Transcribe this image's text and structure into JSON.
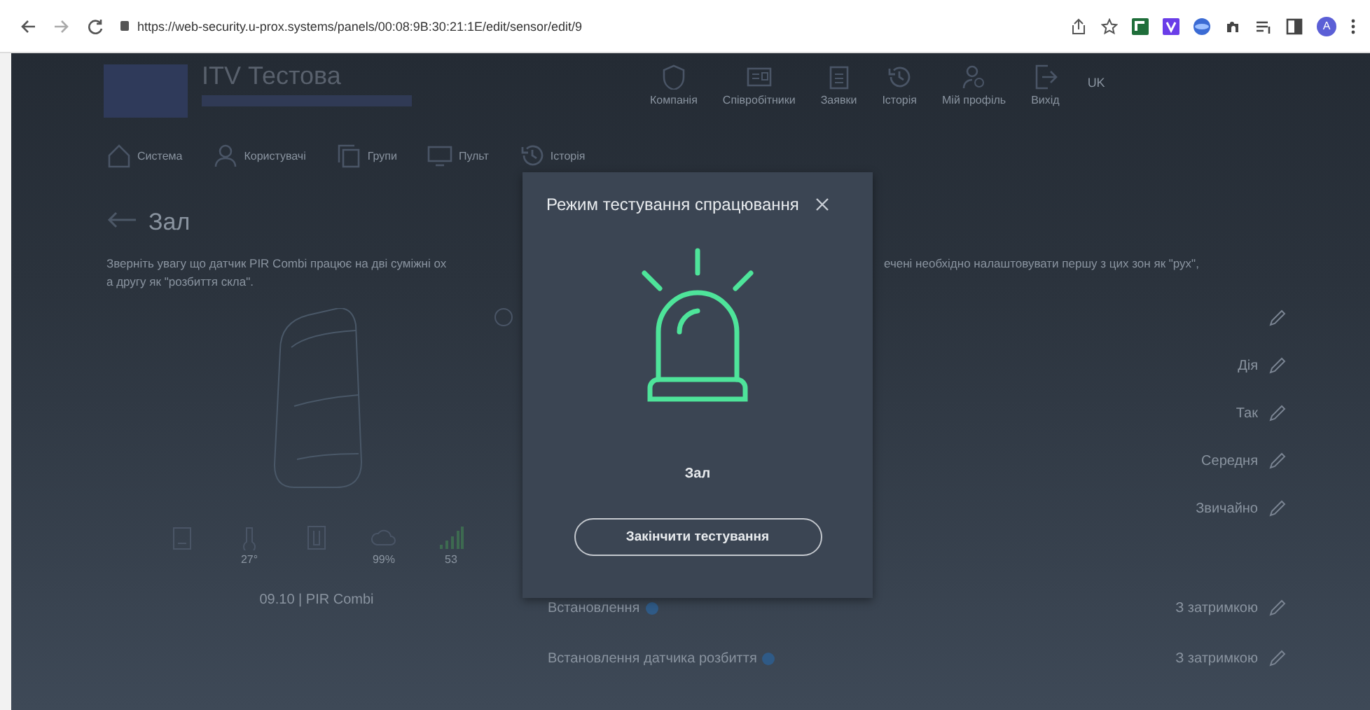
{
  "browser": {
    "url": "https://web-security.u-prox.systems/panels/00:08:9B:30:21:1E/edit/sensor/edit/9",
    "profile_initial": "A"
  },
  "header": {
    "org_name": "ITV Тестова",
    "nav": [
      {
        "kind": "shield",
        "label": "Компанія"
      },
      {
        "kind": "card",
        "label": "Співробітники"
      },
      {
        "kind": "clipboard",
        "label": "Заявки"
      },
      {
        "kind": "history",
        "label": "Історія"
      },
      {
        "kind": "profile",
        "label": "Мій профіль"
      },
      {
        "kind": "exit",
        "label": "Вихід"
      }
    ],
    "language": "UK"
  },
  "section_tabs": [
    {
      "kind": "home",
      "label": "Система"
    },
    {
      "kind": "user",
      "label": "Користувачі"
    },
    {
      "kind": "groups",
      "label": "Групи"
    },
    {
      "kind": "monitor",
      "label": "Пульт"
    },
    {
      "kind": "history",
      "label": "Історія"
    }
  ],
  "page": {
    "title": "Зал",
    "note_left": [
      "Зверніть увагу що датчик PIR Combi працює на дві суміжні ох",
      "а другу як \"розбиття скла\"."
    ],
    "note_right": "ечені необхідно налаштовувати першу з цих зон як \"рух\","
  },
  "sensor": {
    "name": "09.10 | PIR Combi",
    "stats": [
      {
        "kind": "battery"
      },
      {
        "kind": "temperature",
        "value": "27°"
      },
      {
        "kind": "tamper"
      },
      {
        "kind": "humidity",
        "value": "99%"
      },
      {
        "kind": "signal",
        "value": "53"
      }
    ]
  },
  "settings": [
    {
      "value": "Дія"
    },
    {
      "value": "Так"
    },
    {
      "value": "Середня"
    },
    {
      "value": "Звичайно"
    },
    {
      "label": "Встановлення",
      "value": "З затримкою"
    },
    {
      "label": "Встановлення датчика розбиття",
      "value": "З затримкою"
    }
  ],
  "modal": {
    "title": "Режим тестування спрацювання",
    "zone": "Зал",
    "button": "Закінчити тестування"
  }
}
